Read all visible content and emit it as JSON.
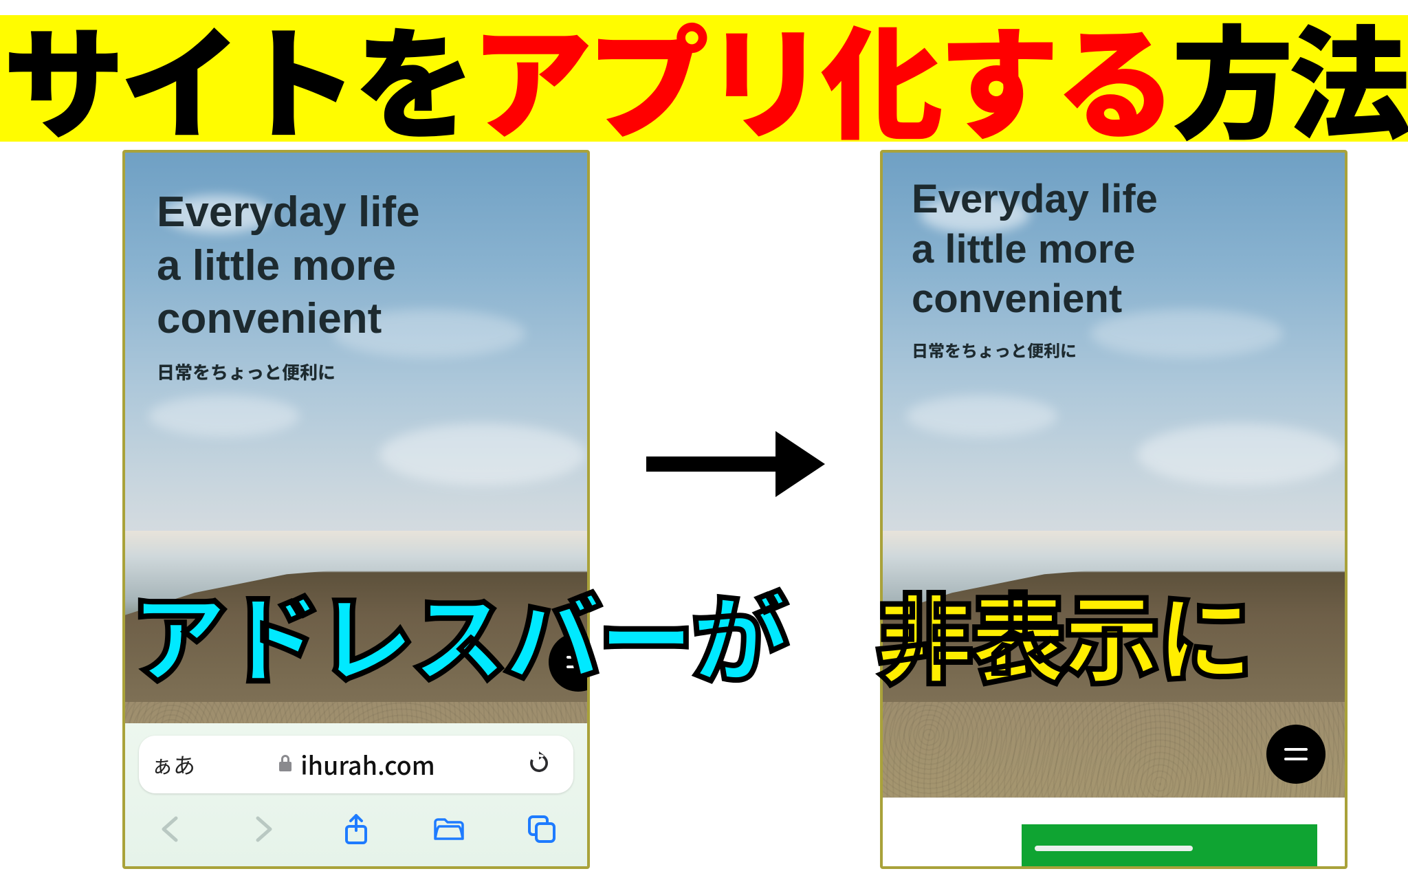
{
  "title": {
    "part1": "サイトを",
    "part2": "アプリ化する",
    "part3": "方法"
  },
  "hero": {
    "line1": "Everyday life",
    "line2": "a little more",
    "line3": "convenient",
    "sub": "日常をちょっと便利に"
  },
  "safari": {
    "textsize": "ぁあ",
    "domain": "ihurah.com"
  },
  "captions": {
    "addressbar": "アドレスバーが",
    "hidden": "非表示に"
  }
}
